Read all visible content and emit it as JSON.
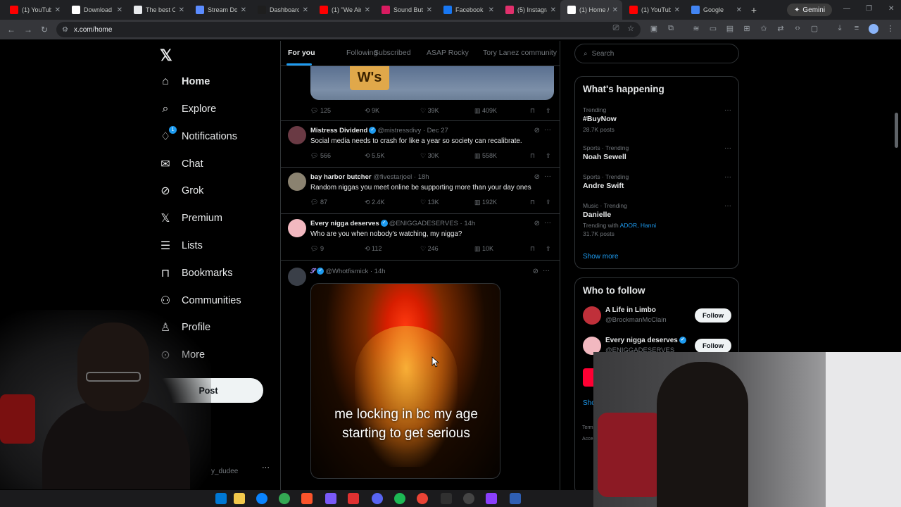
{
  "browser": {
    "tabs": [
      {
        "title": "(1) YouTub",
        "color": "#ff0000",
        "active": false
      },
      {
        "title": "Download",
        "color": "#ffffff",
        "active": false
      },
      {
        "title": "The best Cr",
        "color": "#e8eaed",
        "active": false
      },
      {
        "title": "Stream Do",
        "color": "#5b8cff",
        "active": false
      },
      {
        "title": "Dashboard",
        "color": "#1e1e1e",
        "active": false
      },
      {
        "title": "(1) \"We Ain",
        "color": "#ff0000",
        "active": false
      },
      {
        "title": "Sound Butt",
        "color": "#d81b60",
        "active": false
      },
      {
        "title": "Facebook",
        "color": "#1877f2",
        "active": false
      },
      {
        "title": "(5) Instagra",
        "color": "#e1306c",
        "active": false
      },
      {
        "title": "(1) Home /",
        "color": "#ffffff",
        "active": true
      },
      {
        "title": "(1) YouTub",
        "color": "#ff0000",
        "active": false
      },
      {
        "title": "Google",
        "color": "#4285f4",
        "active": false
      }
    ],
    "new_tab_glyph": "+",
    "gemini_label": "Gemini",
    "url": "x.com/home"
  },
  "sidebar": {
    "logo": "𝕏",
    "items": [
      {
        "label": "Home",
        "icon": "home-icon",
        "glyph": "⌂",
        "active": true
      },
      {
        "label": "Explore",
        "icon": "search-icon",
        "glyph": "⌕",
        "active": false
      },
      {
        "label": "Notifications",
        "icon": "bell-icon",
        "glyph": "♢",
        "active": false,
        "badge": "1"
      },
      {
        "label": "Chat",
        "icon": "mail-icon",
        "glyph": "✉",
        "active": false
      },
      {
        "label": "Grok",
        "icon": "grok-icon",
        "glyph": "⊘",
        "active": false
      },
      {
        "label": "Premium",
        "icon": "x-icon",
        "glyph": "𝕏",
        "active": false
      },
      {
        "label": "Lists",
        "icon": "list-icon",
        "glyph": "☰",
        "active": false
      },
      {
        "label": "Bookmarks",
        "icon": "bookmark-icon",
        "glyph": "⊓",
        "active": false
      },
      {
        "label": "Communities",
        "icon": "people-icon",
        "glyph": "⚇",
        "active": false
      },
      {
        "label": "Profile",
        "icon": "person-icon",
        "glyph": "♙",
        "active": false
      },
      {
        "label": "More",
        "icon": "more-icon",
        "glyph": "⊙",
        "active": false
      }
    ],
    "post_label": "Post",
    "account_handle_partial": "y_dudee",
    "account_menu_glyph": "···"
  },
  "feed": {
    "tabs": [
      "For you",
      "Following",
      "Subscribed",
      "ASAP Rocky",
      "Tory Lanez community"
    ],
    "active_tab": 0,
    "top_media_text": "W's",
    "top_actions": {
      "replies": "125",
      "reposts": "9K",
      "likes": "39K",
      "views": "409K"
    },
    "tweets": [
      {
        "name": "Mistress Dividend",
        "verified": true,
        "handle": "@mistressdivy",
        "time": "Dec 27",
        "text": "Social media needs to crash for like a year so society can recalibrate.",
        "replies": "566",
        "reposts": "5.5K",
        "likes": "30K",
        "views": "558K",
        "avatar_color": "#6a3a44"
      },
      {
        "name": "bay harbor butcher",
        "verified": false,
        "handle": "@fivestarjoel",
        "time": "18h",
        "text": "Random niggas you meet online be supporting more than your day ones",
        "replies": "87",
        "reposts": "2.4K",
        "likes": "13K",
        "views": "192K",
        "avatar_color": "#8a8270"
      },
      {
        "name": "Every nigga deserves",
        "verified": true,
        "handle": "@ENIGGADESERVES",
        "time": "14h",
        "text": "Who are you when nobody's watching, my nigga?",
        "replies": "9",
        "reposts": "112",
        "likes": "246",
        "views": "10K",
        "avatar_color": "#f2b8c0"
      }
    ],
    "meme_tweet": {
      "name": "𝒮",
      "verified": true,
      "handle": "@Whotfismick",
      "time": "14h",
      "caption": "me locking in bc my age starting to get serious",
      "avatar_color": "#3a3f48"
    }
  },
  "right": {
    "search_placeholder": "Search",
    "happening_title": "What's happening",
    "trends": [
      {
        "meta": "Trending",
        "name": "#BuyNow",
        "posts": "28.7K posts"
      },
      {
        "meta": "Sports · Trending",
        "name": "Noah Sewell",
        "posts": ""
      },
      {
        "meta": "Sports · Trending",
        "name": "Andre Swift",
        "posts": ""
      },
      {
        "meta": "Music · Trending",
        "name": "Danielle",
        "trending_with_label": "Trending with",
        "trending_with_links": "ADOR, Hanni",
        "posts": "31.7K posts"
      }
    ],
    "show_more": "Show more",
    "who_to_follow_title": "Who to follow",
    "suggestions": [
      {
        "name": "A Life in Limbo",
        "handle": "@BrockmanMcClain",
        "verified": false,
        "avatar_color": "#c0303a"
      },
      {
        "name": "Every nigga deserves",
        "handle": "@ENIGGADESERVES",
        "verified": true,
        "avatar_color": "#f2b8c0"
      }
    ],
    "follow_label": "Follow",
    "show_partial": "Sho",
    "terms_partial": "Term",
    "access_partial": "Acce"
  }
}
